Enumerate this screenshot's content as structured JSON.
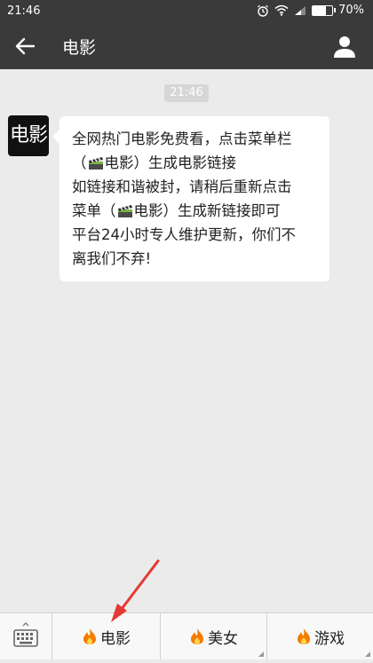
{
  "status_bar": {
    "time": "21:46",
    "battery": "70%",
    "battery_level": 0.7,
    "icons": [
      "alarm-icon",
      "wifi-icon",
      "signal-icon",
      "battery-icon"
    ]
  },
  "header": {
    "title": "电影",
    "icons": [
      "back-arrow-icon",
      "profile-icon"
    ]
  },
  "chat": {
    "timestamp": "21:46",
    "sender_avatar_text": "电影",
    "message": {
      "line1": "全网热门电影免费看，点击菜单栏",
      "line2_open": "（",
      "line2_label": "电影）生成电影链接",
      "line3": "如链接和谐被封，请稍后重新点击",
      "line4_prefix": "菜单（",
      "line4_label": "电影）生成新链接即可",
      "line5": "平台24小时专人维护更新，你们不",
      "line6": "离我们不弃!"
    }
  },
  "menu": {
    "keyboard_icon": "keyboard-icon",
    "items": [
      {
        "label": "电影",
        "icon": "fire-icon"
      },
      {
        "label": "美女",
        "icon": "fire-icon"
      },
      {
        "label": "游戏",
        "icon": "fire-icon"
      }
    ]
  },
  "colors": {
    "header_bg": "#3a3a3a",
    "chat_bg": "#ebebeb",
    "annotation_arrow": "#e53935"
  }
}
